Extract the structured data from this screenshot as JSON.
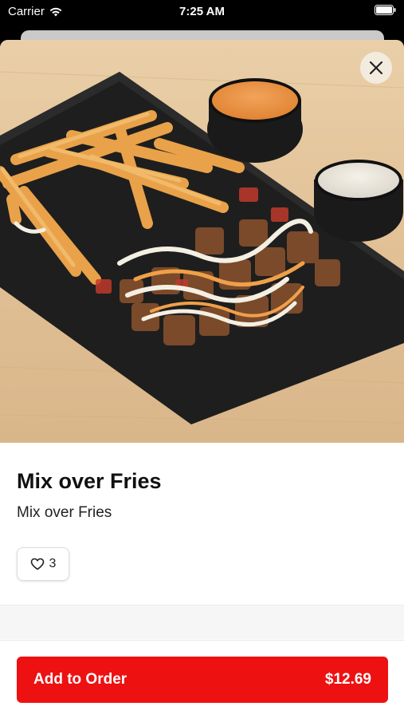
{
  "status_bar": {
    "carrier": "Carrier",
    "time": "7:25 AM"
  },
  "item": {
    "title": "Mix over Fries",
    "description": "Mix over Fries",
    "likes": "3"
  },
  "footer": {
    "add_label": "Add to Order",
    "price": "$12.69"
  },
  "colors": {
    "accent": "#ee1111"
  },
  "icons": {
    "close": "close-icon",
    "like": "heart-icon",
    "wifi": "wifi-icon",
    "battery": "battery-icon"
  }
}
